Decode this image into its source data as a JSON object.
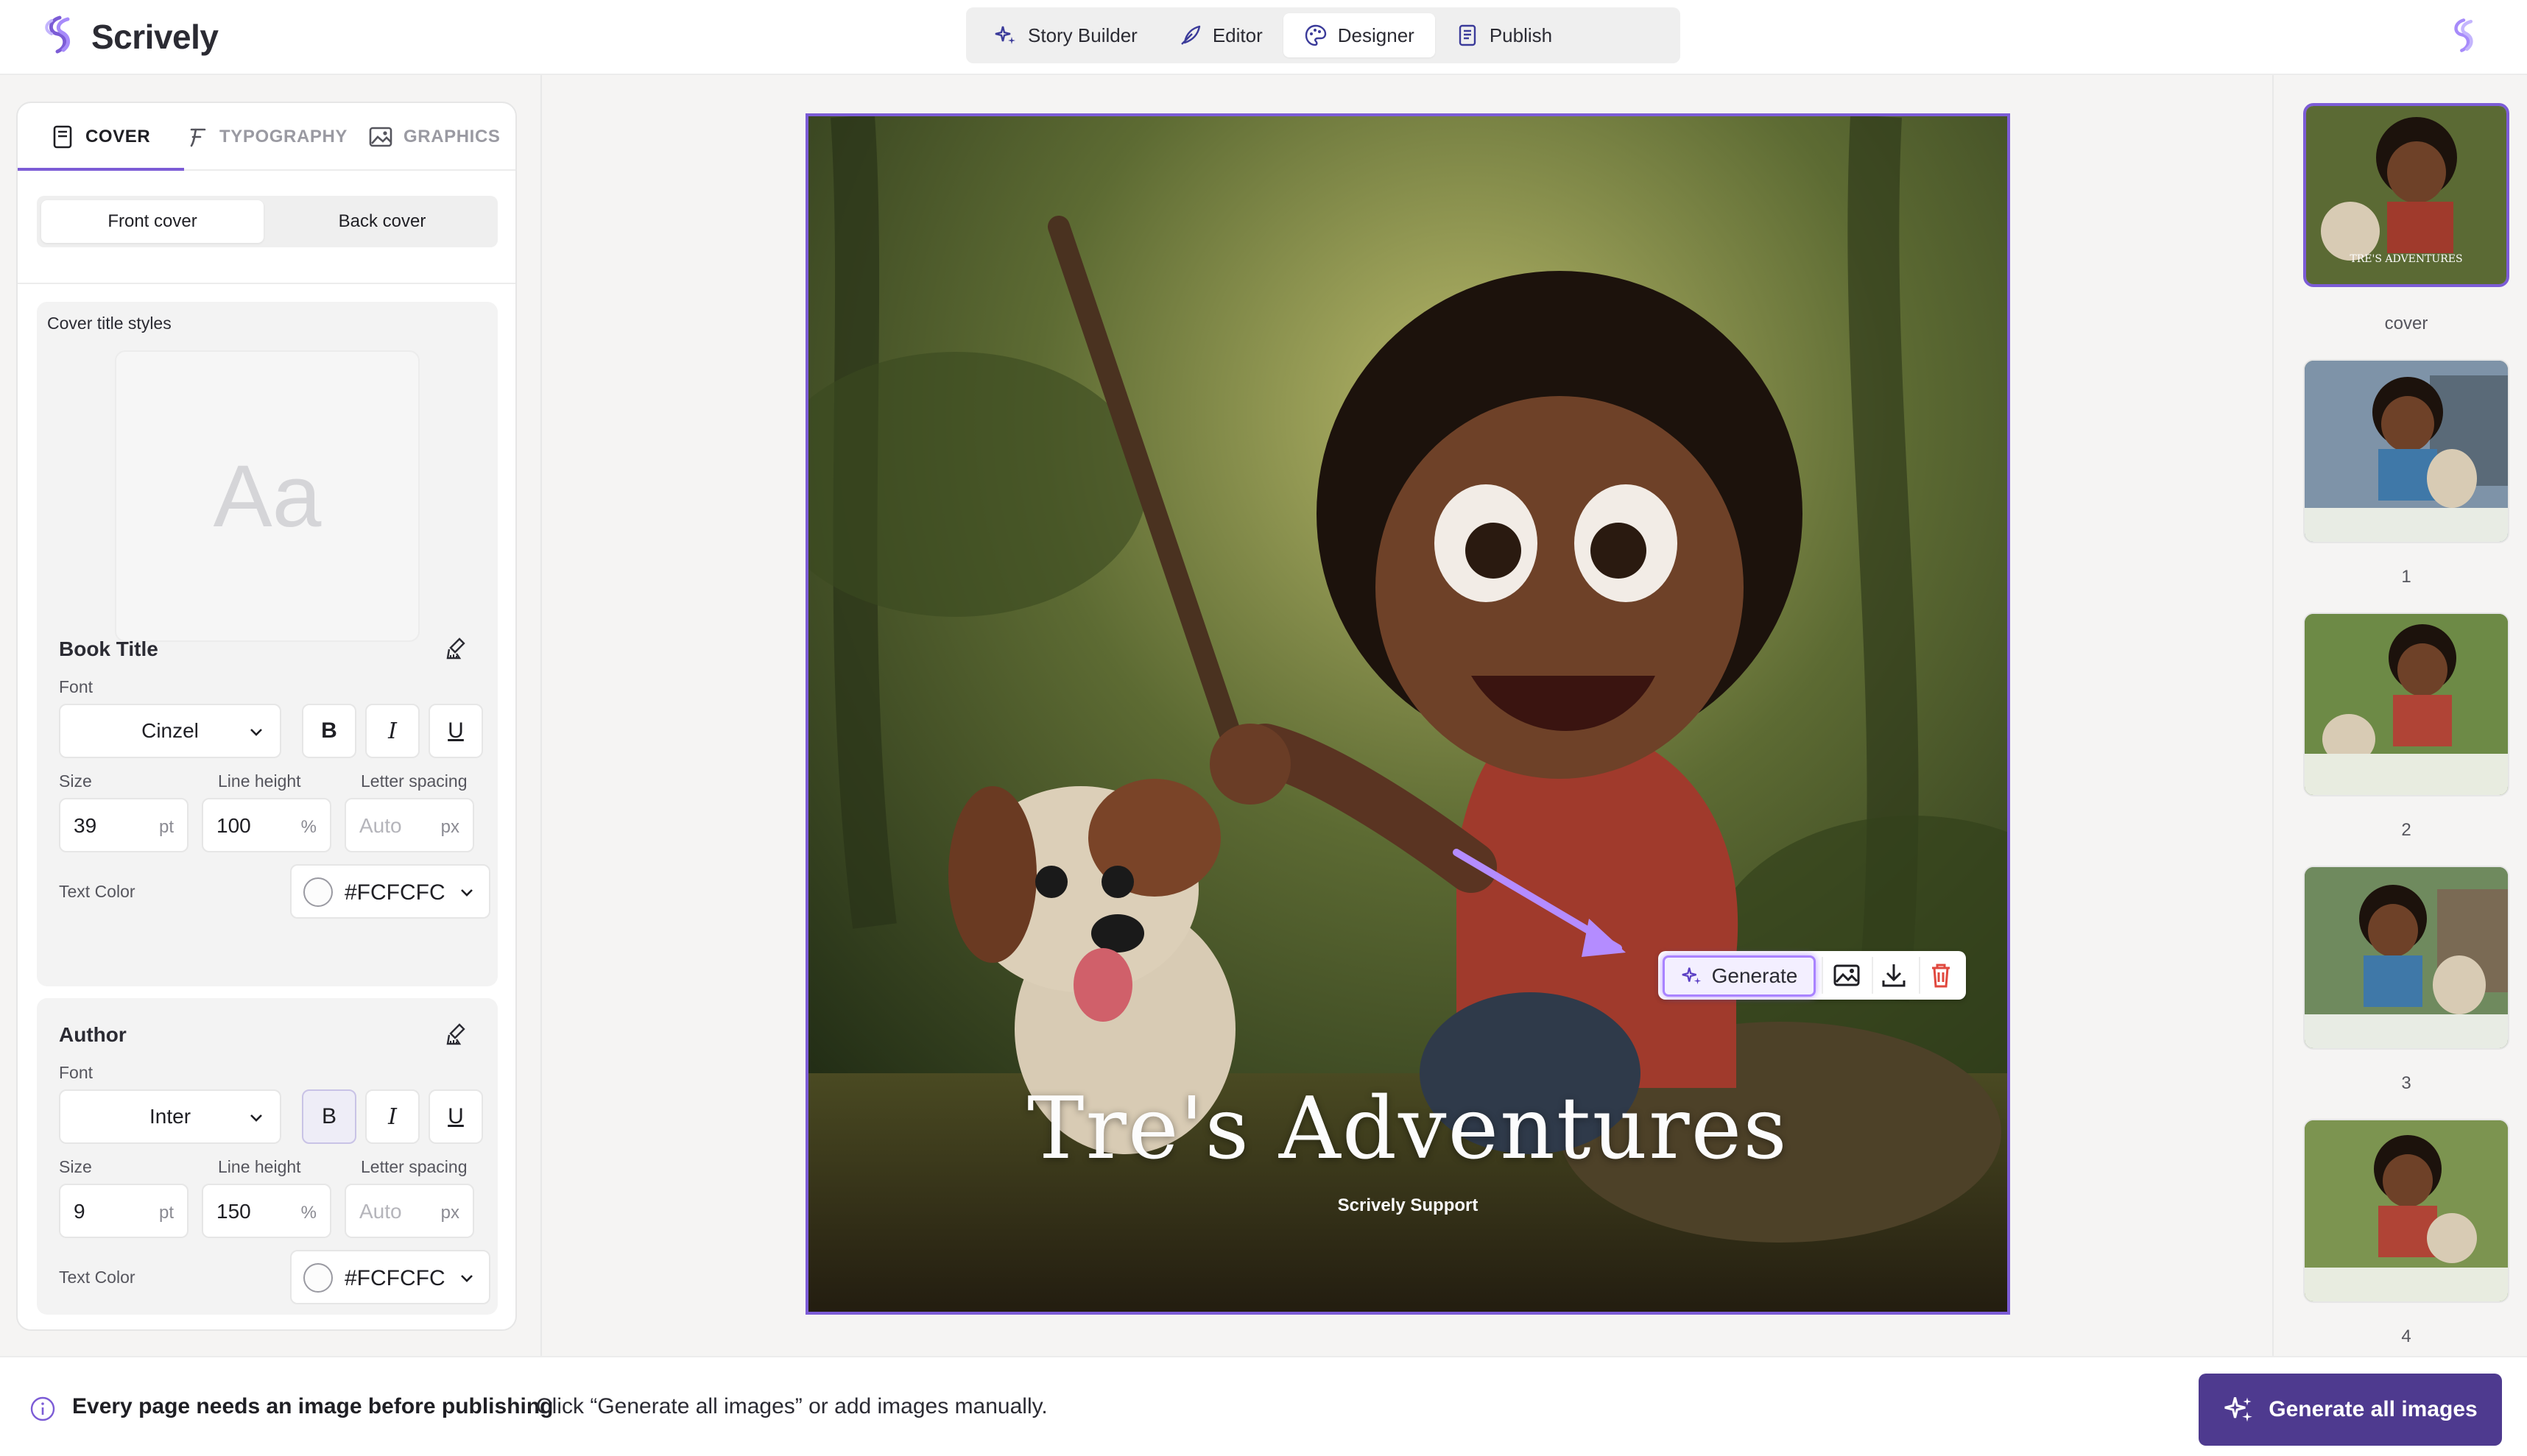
{
  "app": {
    "name": "Scrively",
    "accent": "#7c5cd6"
  },
  "nav": {
    "items": [
      {
        "label": "Story Builder",
        "icon": "sparkle-icon"
      },
      {
        "label": "Editor",
        "icon": "feather-pen-icon"
      },
      {
        "label": "Designer",
        "icon": "palette-icon"
      },
      {
        "label": "Publish",
        "icon": "document-icon"
      }
    ],
    "active": "Designer"
  },
  "left_panel": {
    "tabs": [
      {
        "label": "COVER",
        "icon": "cover-icon"
      },
      {
        "label": "TYPOGRAPHY",
        "icon": "typography-icon"
      },
      {
        "label": "GRAPHICS",
        "icon": "image-icon"
      }
    ],
    "active_tab": "COVER",
    "segmented": {
      "front": "Front cover",
      "back": "Back cover",
      "selected": "Front cover"
    },
    "styles_label": "Cover title styles",
    "preview_text": "Aa",
    "book_title": {
      "heading": "Book Title",
      "font_label": "Font",
      "font": "Cinzel",
      "bold": "B",
      "italic": "I",
      "underline": "U",
      "size_label": "Size",
      "size": "39",
      "size_unit": "pt",
      "line_height_label": "Line height",
      "line_height": "100",
      "line_height_unit": "%",
      "letter_spacing_label": "Letter spacing",
      "letter_spacing_placeholder": "Auto",
      "letter_spacing_unit": "px",
      "text_color_label": "Text Color",
      "text_color": "#FCFCFC"
    },
    "author": {
      "heading": "Author",
      "font_label": "Font",
      "font": "Inter",
      "bold": "B",
      "italic": "I",
      "underline": "U",
      "bold_active": true,
      "size_label": "Size",
      "size": "9",
      "size_unit": "pt",
      "line_height_label": "Line height",
      "line_height": "150",
      "line_height_unit": "%",
      "letter_spacing_label": "Letter spacing",
      "letter_spacing_placeholder": "Auto",
      "letter_spacing_unit": "px",
      "text_color_label": "Text Color",
      "text_color": "#FCFCFC"
    }
  },
  "cover": {
    "title": "Tre's Adventures",
    "author": "Scrively Support",
    "toolbar": {
      "generate_label": "Generate"
    }
  },
  "thumbnails": [
    {
      "label": "cover",
      "active": true
    },
    {
      "label": "1"
    },
    {
      "label": "2"
    },
    {
      "label": "3"
    },
    {
      "label": "4"
    }
  ],
  "bottom": {
    "message": "Every page needs an image before publishing",
    "hint": "Click “Generate all images” or add images manually.",
    "button": "Generate all images"
  }
}
